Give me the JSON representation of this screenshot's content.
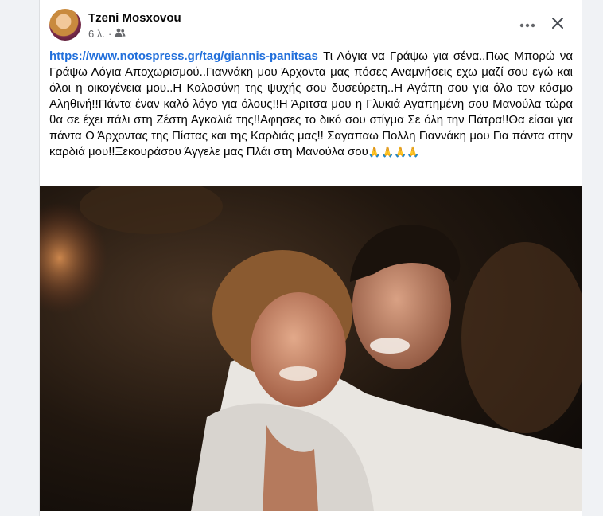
{
  "post": {
    "author": "Tzeni Mosxovou",
    "time": "6 λ.",
    "dot": "·",
    "link": "https://www.notospress.gr/tag/giannis-panitsas",
    "text": "Τι Λόγια να Γράψω για σένα..Πως Μπορώ να Γράψω Λόγια Αποχωρισμού..Γιαννάκη μου Άρχοντα μας πόσες Αναμνήσεις εχω μαζί σου εγώ και όλοι η οικογένεια μου..Η Καλοσύνη της ψυχής σου δυσεύρετη..Η Αγάπη σου για όλο τον κόσμο Αληθινή!!Πάντα έναν καλό λόγο για όλους!!Η Άριτσα μου η Γλυκιά Αγαπημένη σου Μανούλα τώρα θα σε έχει πάλι στη Ζέστη Αγκαλιά της!!Αφησες το δικό σου στίγμα Σε όλη την Πάτρα!!Θα είσαι για πάντα Ο Άρχοντας της Πίστας και της Καρδιάς μας!! Σαγαπαω Πολλη Γιαννάκη μου Για πάντα στην καρδιά μου!!Ξεκουράσου Άγγελε μας Πλάι στη Μανούλα σου",
    "emoji": "🙏🙏🙏🙏"
  },
  "icons": {
    "audience": "friends-icon",
    "more": "more-icon",
    "close": "close-icon"
  },
  "colors": {
    "link": "#216fdb",
    "meta": "#65676b",
    "background": "#f0f2f5",
    "card": "#ffffff"
  }
}
